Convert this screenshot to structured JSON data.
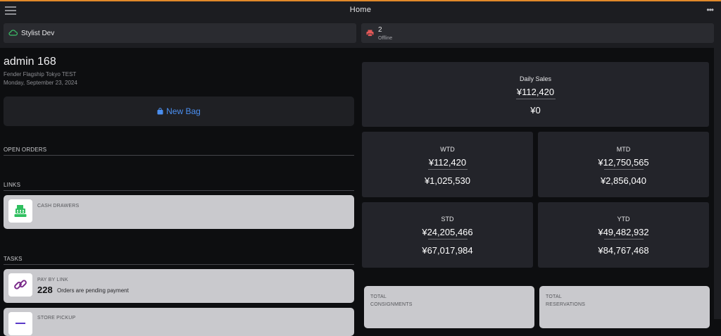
{
  "topbar": {
    "title": "Home",
    "menu_icon": "hamburger-icon",
    "more_icon": "more-dots-icon",
    "more_label": "•••",
    "accent_color": "#e1892a"
  },
  "status": {
    "connection": {
      "icon": "cloud-icon",
      "label": "Stylist Dev",
      "color": "#3cc36a"
    },
    "printer": {
      "icon": "printer-icon",
      "count": "2",
      "state": "Offline",
      "color": "#e45858"
    }
  },
  "user": {
    "name": "admin 168",
    "store": "Fender Flagship Tokyo TEST",
    "date": "Monday, September 23, 2024"
  },
  "new_bag": {
    "icon": "shopping-bag-icon",
    "label": "New Bag",
    "color": "#4b8ff0"
  },
  "sections": {
    "open_orders": "OPEN ORDERS",
    "links": "LINKS",
    "tasks": "TASKS"
  },
  "links": [
    {
      "label": "CASH DRAWERS",
      "icon": "cash-register-icon"
    }
  ],
  "tasks": [
    {
      "label": "PAY BY LINK",
      "count": "228",
      "desc": "Orders are pending payment",
      "icon": "link-icon"
    },
    {
      "label": "STORE PICKUP",
      "icon": "store-pickup-icon"
    }
  ],
  "sales": {
    "daily": {
      "title": "Daily Sales",
      "value": "¥112,420",
      "secondary": "¥0"
    },
    "wtd": {
      "title": "WTD",
      "value": "¥112,420",
      "secondary": "¥1,025,530"
    },
    "mtd": {
      "title": "MTD",
      "value": "¥12,750,565",
      "secondary": "¥2,856,040"
    },
    "std": {
      "title": "STD",
      "value": "¥24,205,466",
      "secondary": "¥67,017,984"
    },
    "ytd": {
      "title": "YTD",
      "value": "¥49,482,932",
      "secondary": "¥84,767,468"
    }
  },
  "totals": {
    "consignments": {
      "label_line1": "TOTAL",
      "label_line2": "CONSIGNMENTS"
    },
    "reservations": {
      "label_line1": "TOTAL",
      "label_line2": "RESERVATIONS"
    }
  }
}
